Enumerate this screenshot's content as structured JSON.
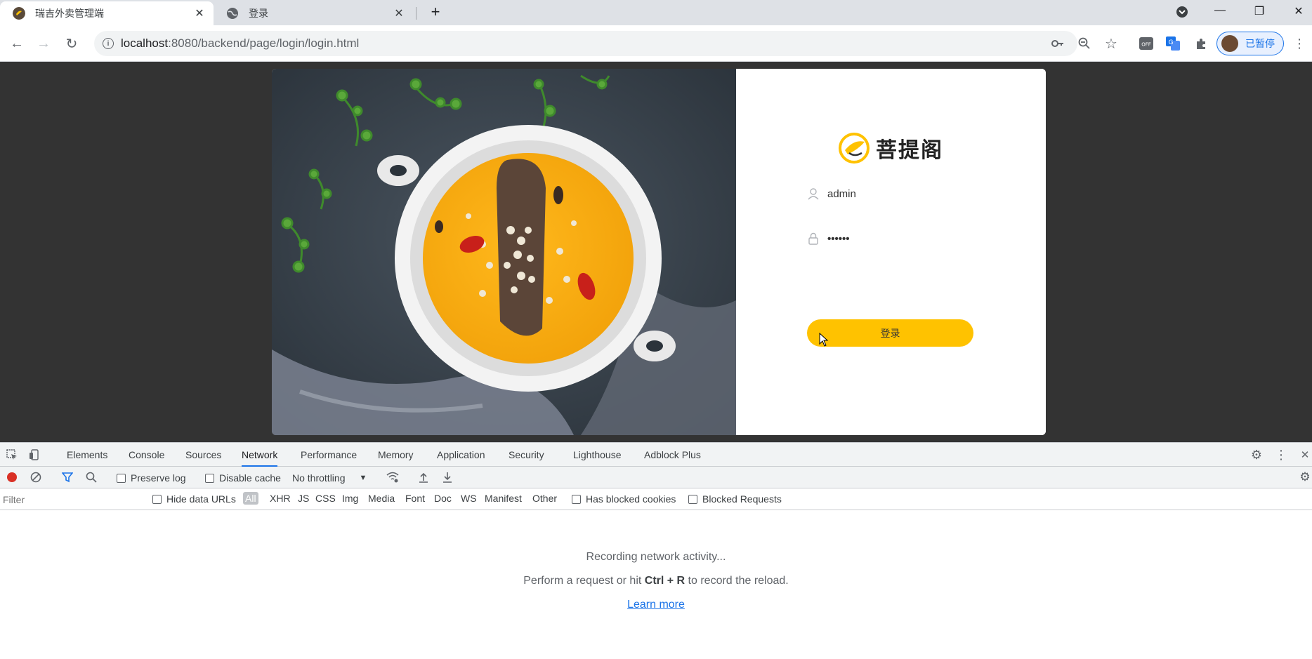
{
  "browser": {
    "tabs": [
      {
        "title": "瑞吉外卖管理端",
        "active": true
      },
      {
        "title": "登录",
        "active": false
      }
    ],
    "new_tab_symbol": "+",
    "url_host": "localhost",
    "url_path": ":8080/backend/page/login/login.html",
    "profile_label": "已暂停",
    "toolbar_icons": [
      "key-icon",
      "zoom-out-icon",
      "star-icon",
      "adblock-off-icon",
      "translate-icon",
      "extensions-icon",
      "menu-icon"
    ]
  },
  "login": {
    "brand": "菩提阁",
    "username_value": "admin",
    "password_value": "••••••",
    "login_button": "登录"
  },
  "devtools": {
    "tabs": [
      "Elements",
      "Console",
      "Sources",
      "Network",
      "Performance",
      "Memory",
      "Application",
      "Security",
      "Lighthouse",
      "Adblock Plus"
    ],
    "active_tab": "Network",
    "preserve_log": "Preserve log",
    "disable_cache": "Disable cache",
    "throttling": "No throttling",
    "filter_placeholder": "Filter",
    "hide_data_urls": "Hide data URLs",
    "filter_types": [
      "All",
      "XHR",
      "JS",
      "CSS",
      "Img",
      "Media",
      "Font",
      "Doc",
      "WS",
      "Manifest",
      "Other"
    ],
    "has_blocked_cookies": "Has blocked cookies",
    "blocked_requests": "Blocked Requests",
    "empty_recording": "Recording network activity...",
    "empty_hint_before": "Perform a request or hit ",
    "empty_hint_keys": "Ctrl + R",
    "empty_hint_after": " to record the reload.",
    "learn_more": "Learn more"
  },
  "colors": {
    "accent_button": "#ffc200",
    "viewport_bg": "#333333",
    "devtools_accent": "#1a73e8",
    "record_red": "#d93025"
  }
}
